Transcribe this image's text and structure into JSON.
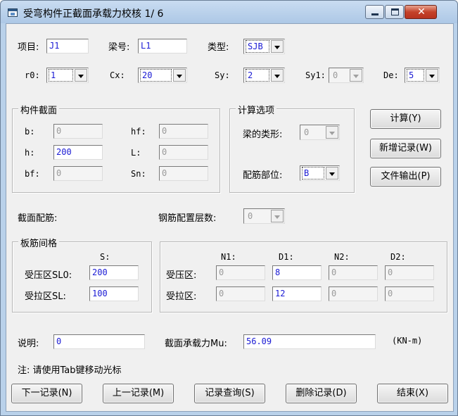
{
  "window": {
    "title": "受弯构件正截面承载力校核 1/ 6"
  },
  "header": {
    "project_label": "项目:",
    "project_value": "J1",
    "beam_label": "梁号:",
    "beam_value": "L1",
    "type_label": "类型:",
    "type_value": "SJB"
  },
  "params": {
    "r0_label": "r0:",
    "r0_value": "1",
    "cx_label": "Cx:",
    "cx_value": "20",
    "sy_label": "Sy:",
    "sy_value": "2",
    "sy1_label": "Sy1:",
    "sy1_value": "0",
    "de_label": "De:",
    "de_value": "5"
  },
  "section": {
    "title": "构件截面",
    "b_label": "b:",
    "b_value": "0",
    "h_label": "h:",
    "h_value": "200",
    "bf_label": "bf:",
    "bf_value": "0",
    "hf_label": "hf:",
    "hf_value": "0",
    "l_label": "L:",
    "l_value": "0",
    "sn_label": "Sn:",
    "sn_value": "0"
  },
  "calc_options": {
    "title": "计算选项",
    "beam_shape_label": "梁的类形:",
    "beam_shape_value": "0",
    "rebar_position_label": "配筋部位:",
    "rebar_position_value": "B"
  },
  "actions": {
    "calculate": "计算(Y)",
    "add_record": "新增记录(W)",
    "file_output": "文件输出(P)"
  },
  "reinforcement": {
    "section_rebar_label": "截面配筋:",
    "layers_label": "钢筋配置层数:",
    "layers_value": "0"
  },
  "slab_spacing": {
    "title": "板筋间格",
    "s_header": "S:",
    "compression_label": "受压区SL0:",
    "compression_value": "200",
    "tension_label": "受拉区SL:",
    "tension_value": "100"
  },
  "rebar_table": {
    "headers": [
      "N1:",
      "D1:",
      "N2:",
      "D2:"
    ],
    "compression_label": "受压区:",
    "compression_values": [
      "0",
      "8",
      "0",
      "0"
    ],
    "tension_label": "受拉区:",
    "tension_values": [
      "0",
      "12",
      "0",
      "0"
    ]
  },
  "notes": {
    "description_label": "说明:",
    "description_value": "0",
    "capacity_label": "截面承载力Mu:",
    "capacity_value": "56.09",
    "capacity_unit": "(KN-m)",
    "hint": "注: 请使用Tab键移动光标"
  },
  "footer": {
    "next": "下一记录(N)",
    "prev": "上一记录(M)",
    "query": "记录查询(S)",
    "delete": "删除记录(D)",
    "end": "结束(X)"
  }
}
